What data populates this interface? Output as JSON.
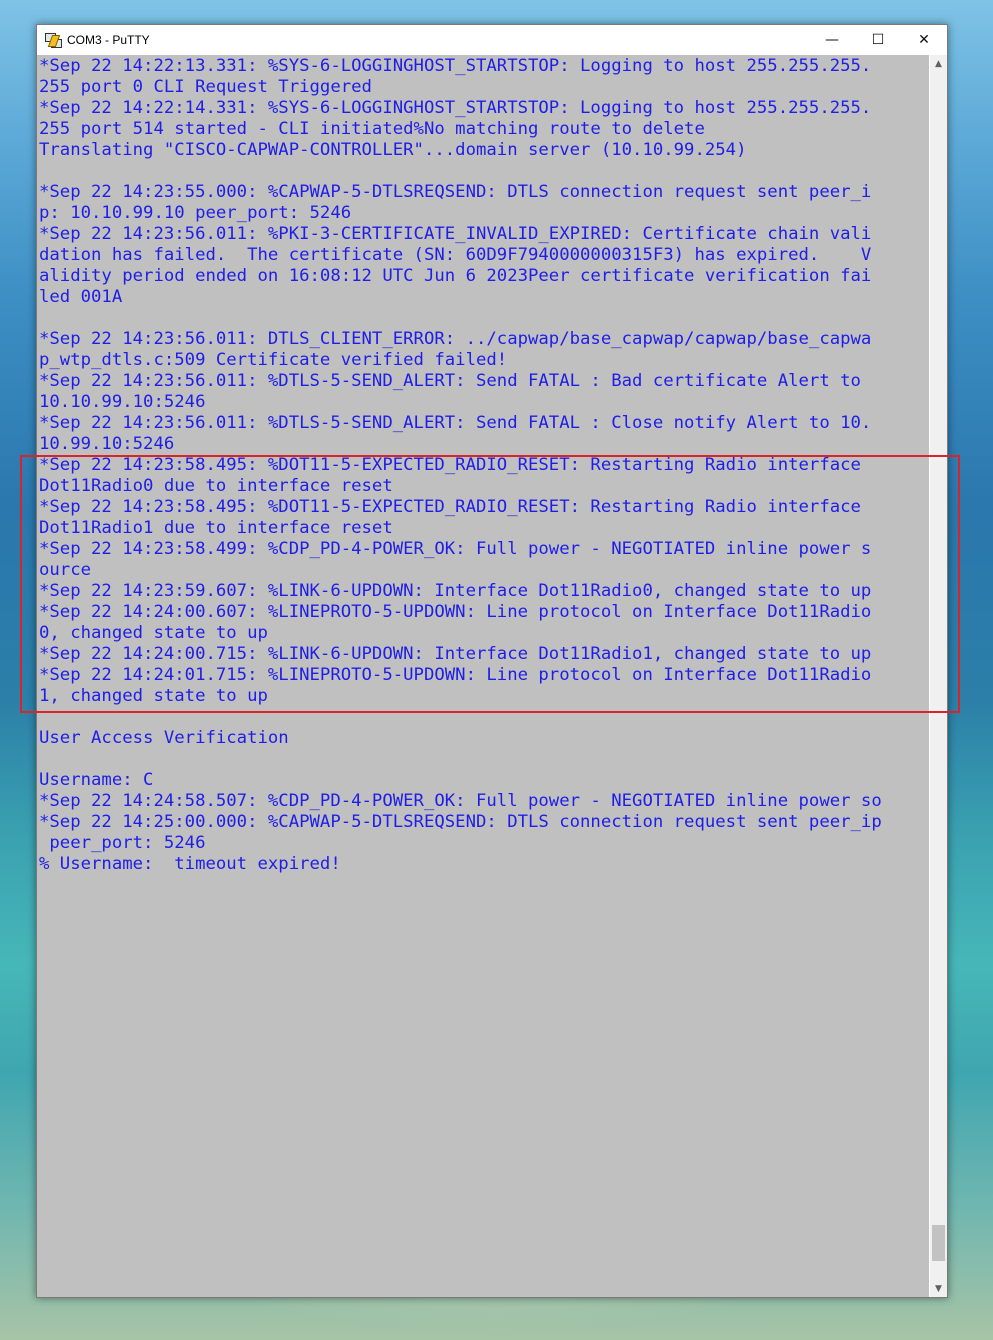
{
  "window": {
    "title": "COM3 - PuTTY",
    "controls": {
      "minimize": "—",
      "maximize": "☐",
      "close": "✕"
    }
  },
  "terminal": {
    "text_color": "#1e1ee8",
    "background_color": "#c0c0c0",
    "lines": [
      "*Sep 22 14:22:13.331: %SYS-6-LOGGINGHOST_STARTSTOP: Logging to host 255.255.255.",
      "255 port 0 CLI Request Triggered",
      "*Sep 22 14:22:14.331: %SYS-6-LOGGINGHOST_STARTSTOP: Logging to host 255.255.255.",
      "255 port 514 started - CLI initiated%No matching route to delete",
      "Translating \"CISCO-CAPWAP-CONTROLLER\"...domain server (10.10.99.254)",
      "",
      "*Sep 22 14:23:55.000: %CAPWAP-5-DTLSREQSEND: DTLS connection request sent peer_i",
      "p: 10.10.99.10 peer_port: 5246",
      "*Sep 22 14:23:56.011: %PKI-3-CERTIFICATE_INVALID_EXPIRED: Certificate chain vali",
      "dation has failed.  The certificate (SN: 60D9F7940000000315F3) has expired.    V",
      "alidity period ended on 16:08:12 UTC Jun 6 2023Peer certificate verification fai",
      "led 001A",
      "",
      "*Sep 22 14:23:56.011: DTLS_CLIENT_ERROR: ../capwap/base_capwap/capwap/base_capwa",
      "p_wtp_dtls.c:509 Certificate verified failed!",
      "*Sep 22 14:23:56.011: %DTLS-5-SEND_ALERT: Send FATAL : Bad certificate Alert to",
      "10.10.99.10:5246",
      "*Sep 22 14:23:56.011: %DTLS-5-SEND_ALERT: Send FATAL : Close notify Alert to 10.",
      "10.99.10:5246",
      "*Sep 22 14:23:58.495: %DOT11-5-EXPECTED_RADIO_RESET: Restarting Radio interface",
      "Dot11Radio0 due to interface reset",
      "*Sep 22 14:23:58.495: %DOT11-5-EXPECTED_RADIO_RESET: Restarting Radio interface",
      "Dot11Radio1 due to interface reset",
      "*Sep 22 14:23:58.499: %CDP_PD-4-POWER_OK: Full power - NEGOTIATED inline power s",
      "ource",
      "*Sep 22 14:23:59.607: %LINK-6-UPDOWN: Interface Dot11Radio0, changed state to up",
      "*Sep 22 14:24:00.607: %LINEPROTO-5-UPDOWN: Line protocol on Interface Dot11Radio",
      "0, changed state to up",
      "*Sep 22 14:24:00.715: %LINK-6-UPDOWN: Interface Dot11Radio1, changed state to up",
      "*Sep 22 14:24:01.715: %LINEPROTO-5-UPDOWN: Line protocol on Interface Dot11Radio",
      "1, changed state to up",
      "",
      "User Access Verification",
      "",
      "Username: C",
      "*Sep 22 14:24:58.507: %CDP_PD-4-POWER_OK: Full power - NEGOTIATED inline power so",
      "*Sep 22 14:25:00.000: %CAPWAP-5-DTLSREQSEND: DTLS connection request sent peer_ip",
      " peer_port: 5246",
      "% Username:  timeout expired!"
    ]
  },
  "annotation": {
    "highlight_color": "#d8242a"
  }
}
